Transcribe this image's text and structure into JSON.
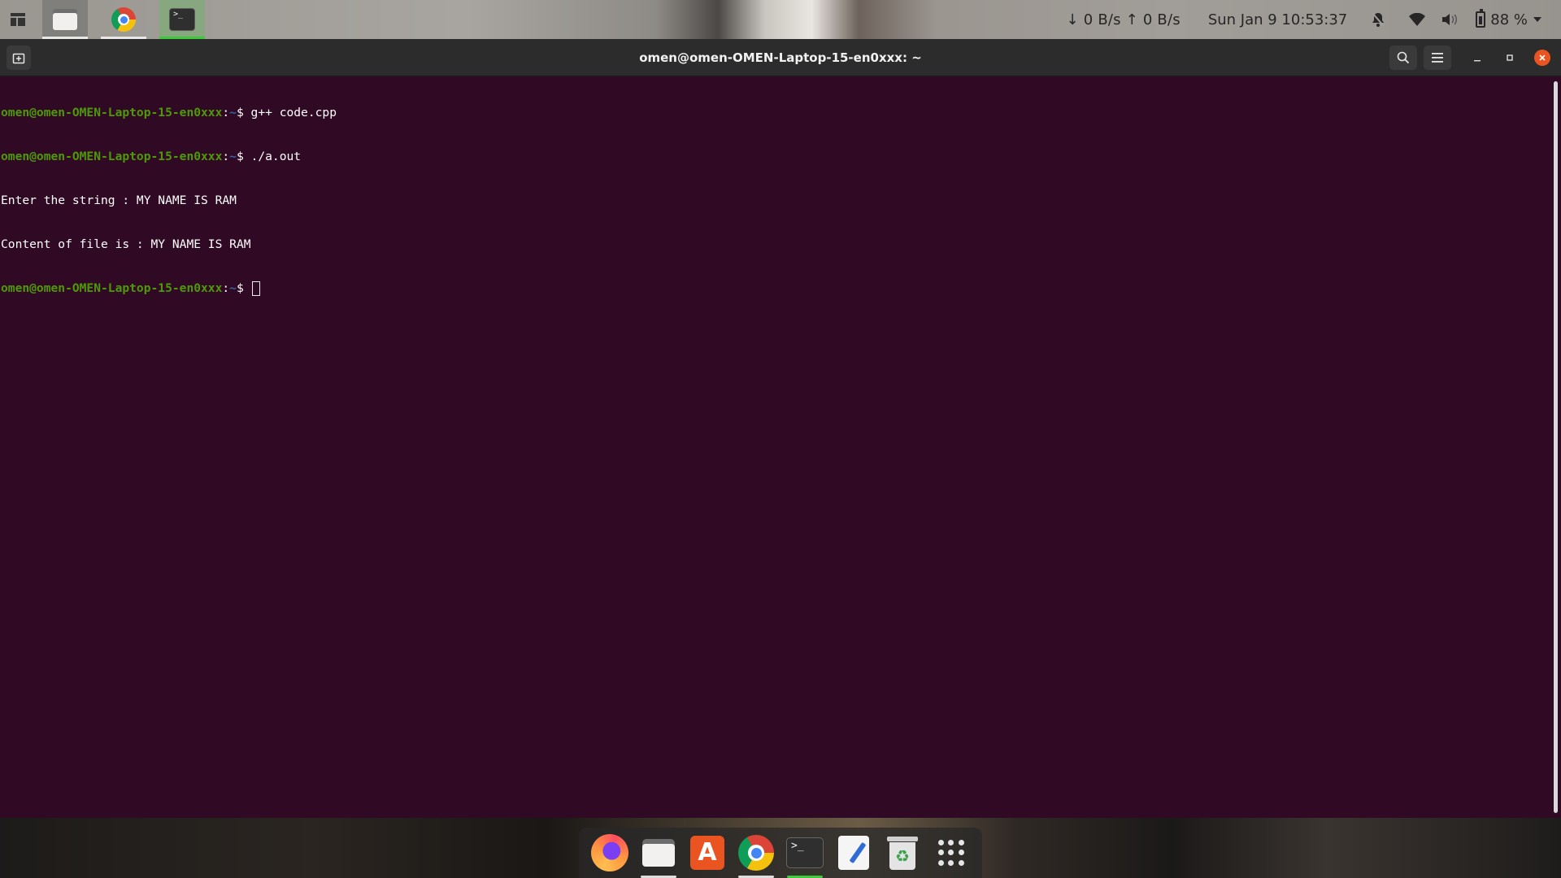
{
  "topbar": {
    "activities_icon": "activities-grid-icon",
    "apps": [
      {
        "name": "files",
        "icon": "files-icon",
        "active": true
      },
      {
        "name": "chrome",
        "icon": "chrome-icon",
        "active": false
      },
      {
        "name": "terminal",
        "icon": "terminal-icon",
        "active": true,
        "accent": "#3ec93a"
      }
    ],
    "net_speed": "↓ 0 B/s ↑ 0 B/s",
    "clock": "Sun Jan 9  10:53:37",
    "battery": "88 %",
    "tray_icons": [
      "notifications-off-icon",
      "wifi-icon",
      "volume-icon",
      "battery-icon",
      "system-menu-caret-icon"
    ]
  },
  "window": {
    "title": "omen@omen-OMEN-Laptop-15-en0xxx: ~",
    "buttons": [
      "new-tab",
      "search",
      "menu",
      "minimize",
      "maximize",
      "close"
    ],
    "close_color": "#e95420",
    "background": "#300a24"
  },
  "terminal": {
    "prompt_user": "omen@omen-OMEN-Laptop-15-en0xxx",
    "prompt_sep": ":",
    "prompt_path": "~",
    "prompt_symbol": "$ ",
    "lines": [
      {
        "type": "cmd",
        "text": "g++ code.cpp"
      },
      {
        "type": "cmd",
        "text": "./a.out"
      },
      {
        "type": "out",
        "text": "Enter the string : MY NAME IS RAM"
      },
      {
        "type": "out",
        "text": "Content of file is : MY NAME IS RAM"
      },
      {
        "type": "cmd",
        "text": ""
      }
    ]
  },
  "dock": {
    "items": [
      {
        "name": "firefox",
        "icon": "firefox-icon",
        "running": false
      },
      {
        "name": "files",
        "icon": "files-icon",
        "running": true
      },
      {
        "name": "software",
        "icon": "app-store-icon",
        "glyph": "A",
        "running": false
      },
      {
        "name": "chrome",
        "icon": "chrome-icon",
        "running": true
      },
      {
        "name": "terminal",
        "icon": "terminal-icon",
        "running": true,
        "accent": "#3ec93a"
      },
      {
        "name": "text-editor",
        "icon": "text-editor-icon",
        "running": false
      },
      {
        "name": "trash",
        "icon": "trash-icon",
        "glyph": "♻",
        "running": false
      },
      {
        "name": "show-apps",
        "icon": "show-apps-grid-icon",
        "running": false
      }
    ]
  }
}
